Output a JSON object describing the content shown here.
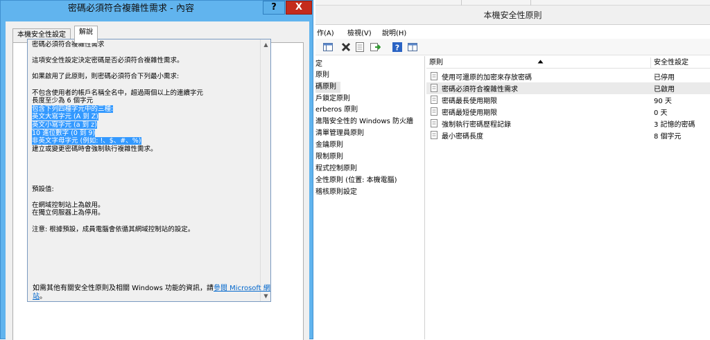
{
  "main_window": {
    "title": "本機安全性原則",
    "menu": [
      "作(A)",
      "檢視(V)",
      "說明(H)"
    ],
    "toolbar_icons": [
      "show-hide-tree-icon",
      "delete-icon",
      "properties-icon",
      "export-icon",
      "help-icon",
      "console-icon"
    ],
    "tree_items": [
      "定",
      "原則",
      "碼原則",
      "戶鎖定原則",
      "erberos 原則",
      "進階安全性的 Windows 防火牆",
      "清單管理員原則",
      "金鑰原則",
      "限制原則",
      "程式控制原則",
      "全性原則 (位置: 本機電腦)",
      "稽核原則設定"
    ],
    "tree_selected_index": 2,
    "list": {
      "col_policy": "原則",
      "col_setting": "安全性設定",
      "rows": [
        {
          "name": "使用可還原的加密來存放密碼",
          "value": "已停用"
        },
        {
          "name": "密碼必須符合複雜性需求",
          "value": "已啟用"
        },
        {
          "name": "密碼最長使用期限",
          "value": "90 天"
        },
        {
          "name": "密碼最短使用期限",
          "value": "0 天"
        },
        {
          "name": "強制執行密碼歷程記錄",
          "value": "3 記憶的密碼"
        },
        {
          "name": "最小密碼長度",
          "value": "8 個字元"
        }
      ],
      "selected_index": 1
    }
  },
  "dialog": {
    "title": "密碼必須符合複雜性需求 - 內容",
    "help_label": "?",
    "close_label": "X",
    "tabs": [
      "本機安全性設定",
      "解說"
    ],
    "explain_lines": [
      {
        "text": "密碼必須符合複雜性需求",
        "hl": false
      },
      {
        "text": "",
        "hl": false
      },
      {
        "text": "這項安全性設定決定密碼是否必須符合複雜性需求。",
        "hl": false
      },
      {
        "text": "",
        "hl": false
      },
      {
        "text": "如果啟用了此原則，則密碼必須符合下列最小需求:",
        "hl": false
      },
      {
        "text": "",
        "hl": false
      },
      {
        "text": "不包含使用者的帳戶名稱全名中，超過兩個以上的連續字元",
        "hl": false
      },
      {
        "text": "長度至少為 6 個字元",
        "hl": false
      },
      {
        "text": "包含下列四種字元中的三種:",
        "hl": true
      },
      {
        "text": "英文大寫字元 (A 到 Z)",
        "hl": true
      },
      {
        "text": "英文小寫字元 (a 到 z)",
        "hl": true
      },
      {
        "text": "10 進位數字 (0 到 9)",
        "hl": true
      },
      {
        "text": "非英文字母字元 (例如: !、$、#、%)",
        "hl": true
      },
      {
        "text": "建立或變更密碼時會強制執行複雜性需求。",
        "hl": false
      },
      {
        "text": "",
        "hl": false
      },
      {
        "text": "",
        "hl": false
      },
      {
        "text": "",
        "hl": false
      },
      {
        "text": "",
        "hl": false
      },
      {
        "text": "預設值:",
        "hl": false
      },
      {
        "text": "",
        "hl": false
      },
      {
        "text": "在網域控制站上為啟用。",
        "hl": false
      },
      {
        "text": "在獨立伺服器上為停用。",
        "hl": false
      },
      {
        "text": "",
        "hl": false
      },
      {
        "text": "注意: 根據預設，成員電腦會依循其網域控制站的設定。",
        "hl": false
      }
    ],
    "more_info_prefix": "如需其他有關安全性原則及相關 Windows 功能的資訊，請",
    "more_info_link": "參閱 Microsoft 網站",
    "more_info_suffix": "。"
  },
  "colors": {
    "dialog_frame": "#61b4ee",
    "close_button": "#c42b1c",
    "selection": "#3399ff",
    "link": "#0066cc"
  }
}
